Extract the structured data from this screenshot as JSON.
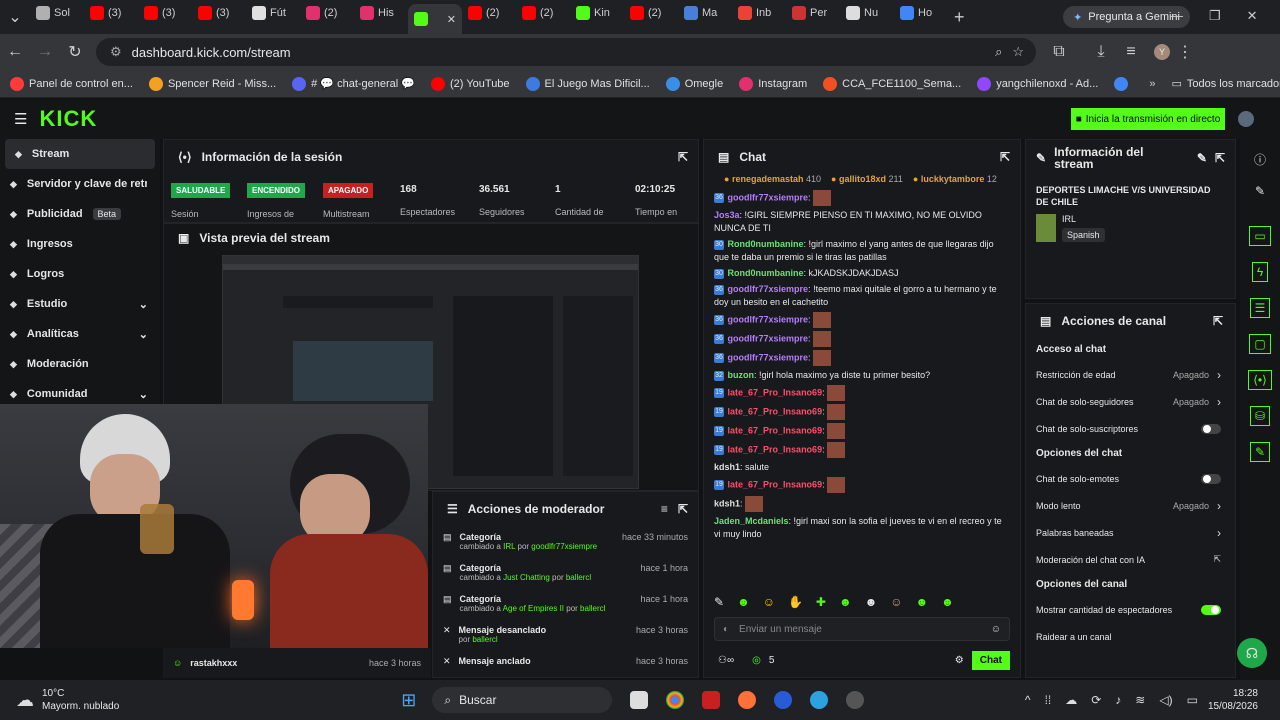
{
  "tabs": [
    {
      "label": "Sol",
      "color": "#b0b0b0"
    },
    {
      "label": "(3)",
      "color": "#ff0000"
    },
    {
      "label": "(3)",
      "color": "#ff0000"
    },
    {
      "label": "(3)",
      "color": "#ff0000"
    },
    {
      "label": "Fút",
      "color": "#e0e0e0"
    },
    {
      "label": "(2)",
      "color": "#e1306c"
    },
    {
      "label": "His",
      "color": "#e1306c"
    },
    {
      "label": "",
      "color": "#53fc18"
    },
    {
      "label": "(2)",
      "color": "#ff0000"
    },
    {
      "label": "(2)",
      "color": "#ff0000"
    },
    {
      "label": "Kin",
      "color": "#53fc18"
    },
    {
      "label": "(2)",
      "color": "#ff0000"
    },
    {
      "label": "Ma",
      "color": "#4a7fd8"
    },
    {
      "label": "Inb",
      "color": "#ea4335"
    },
    {
      "label": "Per",
      "color": "#c33"
    },
    {
      "label": "Nu",
      "color": "#ddd"
    },
    {
      "label": "Ho",
      "color": "#4285f4"
    }
  ],
  "gemini": "Pregunta a Gemini",
  "url": "dashboard.kick.com/stream",
  "bookmarks": [
    {
      "label": "Panel de control en...",
      "color": "#ff3b3b"
    },
    {
      "label": "Spencer Reid - Miss...",
      "color": "#f4a020"
    },
    {
      "label": "# 💬 chat-general 💬",
      "color": "#5865f2"
    },
    {
      "label": "(2) YouTube",
      "color": "#ff0000"
    },
    {
      "label": "El Juego Mas Dificil...",
      "color": "#3d7be0"
    },
    {
      "label": "Omegle",
      "color": "#3a8ee6"
    },
    {
      "label": "Instagram",
      "color": "#e1306c"
    },
    {
      "label": "CCA_FCE1100_Sema...",
      "color": "#f25022"
    },
    {
      "label": "yangchilenoxd - Ad...",
      "color": "#9146ff"
    },
    {
      "label": "",
      "color": "#4285f4"
    }
  ],
  "all_bookmarks": "Todos los marcadores",
  "logo": "KICK",
  "go_live": "Inicia la transmisión en directo",
  "sidebar": [
    {
      "label": "Stream",
      "icon": "home-icon"
    },
    {
      "label": "Servidor y clave de retransmisión",
      "icon": "key-icon"
    },
    {
      "label": "Publicidad",
      "icon": "ad-icon",
      "badge": "Beta"
    },
    {
      "label": "Ingresos",
      "icon": "money-icon"
    },
    {
      "label": "Logros",
      "icon": "trophy-icon"
    },
    {
      "label": "Estudio",
      "icon": "studio-icon",
      "chev": "⌄"
    },
    {
      "label": "Analíticas",
      "icon": "chart-icon",
      "chev": "⌄"
    },
    {
      "label": "Moderación",
      "icon": "shield-icon"
    },
    {
      "label": "Comunidad",
      "icon": "users-icon",
      "chev": "⌄"
    }
  ],
  "session": {
    "title": "Información de la sesión",
    "pills": [
      {
        "label": "SALUDABLE",
        "color": "#1ea84a",
        "sub": "Sesión"
      },
      {
        "label": "ENCENDIDO",
        "color": "#1ea84a",
        "sub": "Ingresos de"
      },
      {
        "label": "APAGADO",
        "color": "#c8201e",
        "sub": "Multistream"
      }
    ],
    "stats": [
      {
        "value": "168",
        "label": "Espectadores"
      },
      {
        "value": "36.561",
        "label": "Seguidores"
      },
      {
        "value": "1",
        "label": "Cantidad de"
      },
      {
        "value": "02:10:25",
        "label": "Tiempo en"
      }
    ]
  },
  "preview": {
    "title": "Vista previa del stream"
  },
  "mod_actions": {
    "title": "Acciones de moderador",
    "items": [
      {
        "title": "Categoría",
        "desc_pre": "cambiado a",
        "cat": "IRL",
        "por": "por",
        "user": "goodlfr77xsiempre",
        "time": "hace 33 minutos"
      },
      {
        "title": "Categoría",
        "desc_pre": "cambiado a",
        "cat": "Just Chatting",
        "por": "por",
        "user": "ballercl",
        "time": "hace 1 hora"
      },
      {
        "title": "Categoría",
        "desc_pre": "cambiado a",
        "cat": "Age of Empires II",
        "por": "por",
        "user": "ballercl",
        "time": "hace 1 hora"
      },
      {
        "title": "Mensaje desanclado",
        "desc_pre": "por",
        "cat": "",
        "por": "",
        "user": "ballercl",
        "time": "hace 3 horas"
      },
      {
        "title": "Mensaje anclado",
        "desc_pre": "",
        "cat": "",
        "por": "",
        "user": "",
        "time": "hace 3 horas"
      }
    ]
  },
  "activity": {
    "user": "rastakhxxx",
    "time": "hace 3 horas"
  },
  "chat": {
    "title": "Chat",
    "top": [
      {
        "name": "renegademastah",
        "count": "410"
      },
      {
        "name": "gallito18xd",
        "count": "211"
      },
      {
        "name": "luckkytambore",
        "count": "12"
      }
    ],
    "messages": [
      {
        "badge": "36",
        "user": "goodlfr77xsiempre",
        "cls": "u1",
        "text": "",
        "emote": true
      },
      {
        "badge": "",
        "user": "Jos3a",
        "cls": "u1",
        "text": "!GIRL SIEMPRE PIENSO EN TI MAXIMO, NO ME OLVIDO NUNCA DE TI",
        "emote": false
      },
      {
        "badge": "30",
        "user": "Rond0numbanine",
        "cls": "u2",
        "text": "!girl maximo el yang antes de que llegaras dijo que te daba un premio si le tiras las patillas",
        "emote": false
      },
      {
        "badge": "30",
        "user": "Rond0numbanine",
        "cls": "u2",
        "text": "kJKADSKJDAKJDASJ",
        "emote": false
      },
      {
        "badge": "36",
        "user": "goodlfr77xsiempre",
        "cls": "u1",
        "text": "!teemo maxi quitale el gorro a tu hermano y te doy un besito en el cachetito",
        "emote": false
      },
      {
        "badge": "36",
        "user": "goodlfr77xsiempre",
        "cls": "u1",
        "text": "",
        "emote": true
      },
      {
        "badge": "36",
        "user": "goodlfr77xsiempre",
        "cls": "u1",
        "text": "",
        "emote": true
      },
      {
        "badge": "36",
        "user": "goodlfr77xsiempre",
        "cls": "u1",
        "text": "",
        "emote": true
      },
      {
        "badge": "32",
        "user": "buzon",
        "cls": "u2",
        "text": "!girl hola maximo ya diste tu primer besito?",
        "emote": false
      },
      {
        "badge": "19",
        "user": "late_67_Pro_Insano69",
        "cls": "u3",
        "text": "",
        "emote": true
      },
      {
        "badge": "19",
        "user": "late_67_Pro_Insano69",
        "cls": "u3",
        "text": "",
        "emote": true
      },
      {
        "badge": "19",
        "user": "late_67_Pro_Insano69",
        "cls": "u3",
        "text": "",
        "emote": true
      },
      {
        "badge": "19",
        "user": "late_67_Pro_Insano69",
        "cls": "u3",
        "text": "",
        "emote": true
      },
      {
        "badge": "",
        "user": "kdsh1",
        "cls": "u4",
        "text": "salute",
        "emote": false
      },
      {
        "badge": "19",
        "user": "late_67_Pro_Insano69",
        "cls": "u3",
        "text": "",
        "emote": true
      },
      {
        "badge": "",
        "user": "kdsh1",
        "cls": "u4",
        "text": "",
        "emote": true
      },
      {
        "badge": "",
        "user": "Jaden_Mcdaniels",
        "cls": "u2",
        "text": "!girl maxi son la sofia el jueves te vi en el recreo y te vi muy lindo",
        "emote": false
      }
    ],
    "input_placeholder": "Enviar un mensaje",
    "count": "5",
    "send": "Chat"
  },
  "stream_info": {
    "title": "Información del stream",
    "stream_title": "DEPORTES LIMACHE V/S UNIVERSIDAD DE CHILE",
    "category": "IRL",
    "language": "Spanish"
  },
  "channel_actions": {
    "title": "Acciones de canal",
    "chat_access": "Acceso al chat",
    "items1": [
      {
        "label": "Restricción de edad",
        "value": "Apagado",
        "type": "chev"
      },
      {
        "label": "Chat de solo-seguidores",
        "value": "Apagado",
        "type": "chev"
      },
      {
        "label": "Chat de solo-suscriptores",
        "value": "",
        "type": "toggle",
        "on": false
      }
    ],
    "chat_options": "Opciones del chat",
    "items2": [
      {
        "label": "Chat de solo-emotes",
        "value": "",
        "type": "toggle",
        "on": false
      },
      {
        "label": "Modo lento",
        "value": "Apagado",
        "type": "chev"
      },
      {
        "label": "Palabras baneadas",
        "value": "",
        "type": "chev"
      },
      {
        "label": "Moderación del chat con IA",
        "value": "",
        "type": "ext"
      }
    ],
    "channel_options": "Opciones del canal",
    "items3": [
      {
        "label": "Mostrar cantidad de espectadores",
        "value": "",
        "type": "toggle",
        "on": true
      },
      {
        "label": "Raidear a un canal",
        "value": "",
        "type": "none"
      }
    ]
  },
  "taskbar": {
    "temp": "10°C",
    "weather": "Mayorm. nublado",
    "search": "Buscar",
    "time": "18:28",
    "date": "15/08/2026"
  }
}
